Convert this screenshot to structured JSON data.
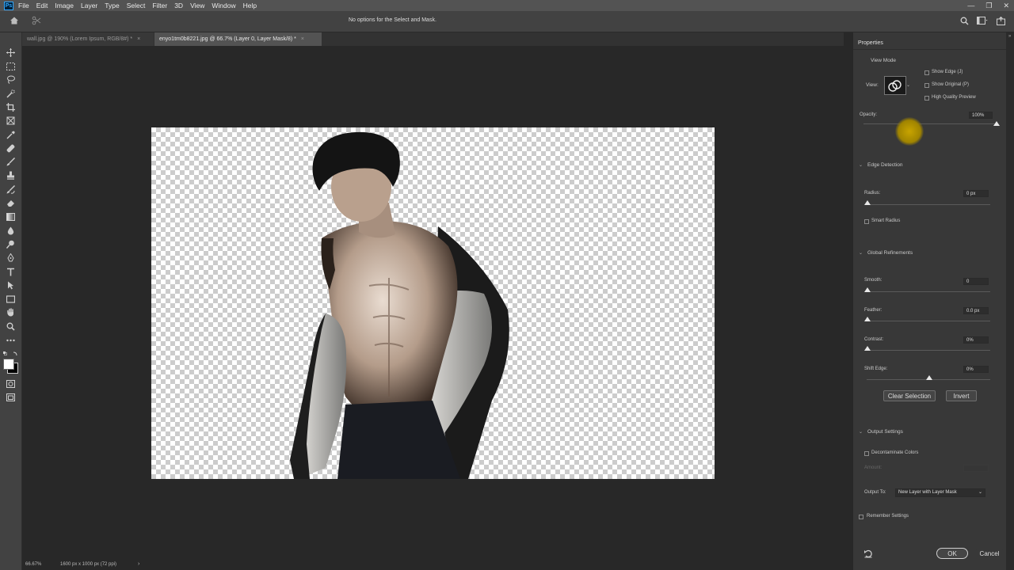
{
  "app": {
    "logo": "Ps"
  },
  "menu": [
    "File",
    "Edit",
    "Image",
    "Layer",
    "Type",
    "Select",
    "Filter",
    "3D",
    "View",
    "Window",
    "Help"
  ],
  "options_bar": {
    "message": "No options for the Select and Mask."
  },
  "tabs": [
    {
      "label": "wall.jpg @ 190% (Lorem Ipsum, RGB/8#) *",
      "close": "×"
    },
    {
      "label": "enyo1tm0b8221.jpg @ 66.7% (Layer 0, Layer Mask/8) *",
      "close": "×"
    }
  ],
  "status": {
    "zoom": "66.67%",
    "doc_size": "1600 px x 1000 px (72 ppi)",
    "arrow": "›"
  },
  "panel": {
    "title": "Properties",
    "view_mode": {
      "heading": "View Mode",
      "view_label": "View:",
      "show_edge": "Show Edge (J)",
      "show_original": "Show Original (P)",
      "high_quality": "High Quality Preview"
    },
    "opacity": {
      "label": "Opacity:",
      "value": "100%",
      "level": 1.0
    },
    "edge_detection": {
      "heading": "Edge Detection",
      "radius_label": "Radius:",
      "radius_value": "0 px",
      "radius_level": 0.0,
      "smart_radius": "Smart Radius"
    },
    "global_refinements": {
      "heading": "Global Refinements",
      "smooth_label": "Smooth:",
      "smooth_value": "0",
      "smooth_level": 0.0,
      "feather_label": "Feather:",
      "feather_value": "0.0 px",
      "feather_level": 0.0,
      "contrast_label": "Contrast:",
      "contrast_value": "0%",
      "contrast_level": 0.0,
      "shift_label": "Shift Edge:",
      "shift_value": "0%",
      "shift_level": 0.5,
      "clear_selection": "Clear Selection",
      "invert": "Invert"
    },
    "output_settings": {
      "heading": "Output Settings",
      "decontaminate": "Decontaminate Colors",
      "amount_label": "Amount:",
      "output_to_label": "Output To:",
      "output_to_value": "New Layer with Layer Mask"
    },
    "remember": "Remember Settings",
    "ok": "OK",
    "cancel": "Cancel"
  }
}
